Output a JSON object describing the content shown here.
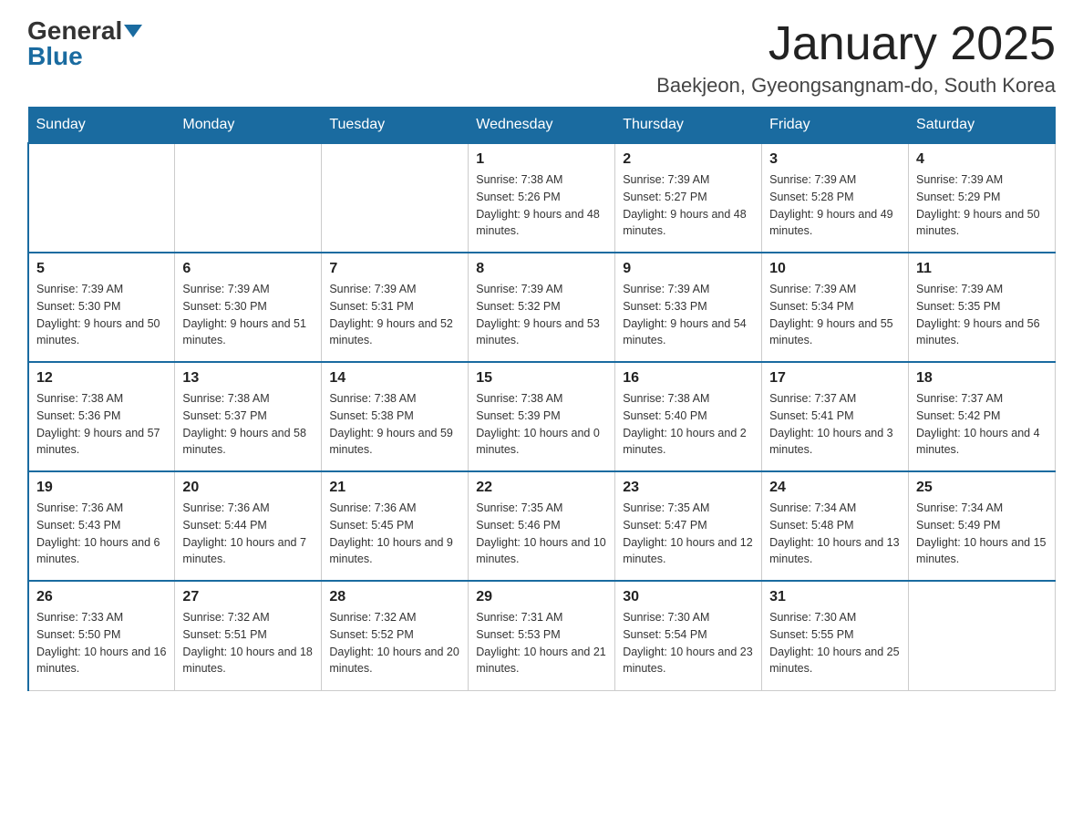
{
  "logo": {
    "general": "General",
    "blue": "Blue"
  },
  "title": "January 2025",
  "location": "Baekjeon, Gyeongsangnam-do, South Korea",
  "days_of_week": [
    "Sunday",
    "Monday",
    "Tuesday",
    "Wednesday",
    "Thursday",
    "Friday",
    "Saturday"
  ],
  "weeks": [
    [
      {
        "day": "",
        "info": ""
      },
      {
        "day": "",
        "info": ""
      },
      {
        "day": "",
        "info": ""
      },
      {
        "day": "1",
        "sunrise": "7:38 AM",
        "sunset": "5:26 PM",
        "daylight": "9 hours and 48 minutes."
      },
      {
        "day": "2",
        "sunrise": "7:39 AM",
        "sunset": "5:27 PM",
        "daylight": "9 hours and 48 minutes."
      },
      {
        "day": "3",
        "sunrise": "7:39 AM",
        "sunset": "5:28 PM",
        "daylight": "9 hours and 49 minutes."
      },
      {
        "day": "4",
        "sunrise": "7:39 AM",
        "sunset": "5:29 PM",
        "daylight": "9 hours and 50 minutes."
      }
    ],
    [
      {
        "day": "5",
        "sunrise": "7:39 AM",
        "sunset": "5:30 PM",
        "daylight": "9 hours and 50 minutes."
      },
      {
        "day": "6",
        "sunrise": "7:39 AM",
        "sunset": "5:30 PM",
        "daylight": "9 hours and 51 minutes."
      },
      {
        "day": "7",
        "sunrise": "7:39 AM",
        "sunset": "5:31 PM",
        "daylight": "9 hours and 52 minutes."
      },
      {
        "day": "8",
        "sunrise": "7:39 AM",
        "sunset": "5:32 PM",
        "daylight": "9 hours and 53 minutes."
      },
      {
        "day": "9",
        "sunrise": "7:39 AM",
        "sunset": "5:33 PM",
        "daylight": "9 hours and 54 minutes."
      },
      {
        "day": "10",
        "sunrise": "7:39 AM",
        "sunset": "5:34 PM",
        "daylight": "9 hours and 55 minutes."
      },
      {
        "day": "11",
        "sunrise": "7:39 AM",
        "sunset": "5:35 PM",
        "daylight": "9 hours and 56 minutes."
      }
    ],
    [
      {
        "day": "12",
        "sunrise": "7:38 AM",
        "sunset": "5:36 PM",
        "daylight": "9 hours and 57 minutes."
      },
      {
        "day": "13",
        "sunrise": "7:38 AM",
        "sunset": "5:37 PM",
        "daylight": "9 hours and 58 minutes."
      },
      {
        "day": "14",
        "sunrise": "7:38 AM",
        "sunset": "5:38 PM",
        "daylight": "9 hours and 59 minutes."
      },
      {
        "day": "15",
        "sunrise": "7:38 AM",
        "sunset": "5:39 PM",
        "daylight": "10 hours and 0 minutes."
      },
      {
        "day": "16",
        "sunrise": "7:38 AM",
        "sunset": "5:40 PM",
        "daylight": "10 hours and 2 minutes."
      },
      {
        "day": "17",
        "sunrise": "7:37 AM",
        "sunset": "5:41 PM",
        "daylight": "10 hours and 3 minutes."
      },
      {
        "day": "18",
        "sunrise": "7:37 AM",
        "sunset": "5:42 PM",
        "daylight": "10 hours and 4 minutes."
      }
    ],
    [
      {
        "day": "19",
        "sunrise": "7:36 AM",
        "sunset": "5:43 PM",
        "daylight": "10 hours and 6 minutes."
      },
      {
        "day": "20",
        "sunrise": "7:36 AM",
        "sunset": "5:44 PM",
        "daylight": "10 hours and 7 minutes."
      },
      {
        "day": "21",
        "sunrise": "7:36 AM",
        "sunset": "5:45 PM",
        "daylight": "10 hours and 9 minutes."
      },
      {
        "day": "22",
        "sunrise": "7:35 AM",
        "sunset": "5:46 PM",
        "daylight": "10 hours and 10 minutes."
      },
      {
        "day": "23",
        "sunrise": "7:35 AM",
        "sunset": "5:47 PM",
        "daylight": "10 hours and 12 minutes."
      },
      {
        "day": "24",
        "sunrise": "7:34 AM",
        "sunset": "5:48 PM",
        "daylight": "10 hours and 13 minutes."
      },
      {
        "day": "25",
        "sunrise": "7:34 AM",
        "sunset": "5:49 PM",
        "daylight": "10 hours and 15 minutes."
      }
    ],
    [
      {
        "day": "26",
        "sunrise": "7:33 AM",
        "sunset": "5:50 PM",
        "daylight": "10 hours and 16 minutes."
      },
      {
        "day": "27",
        "sunrise": "7:32 AM",
        "sunset": "5:51 PM",
        "daylight": "10 hours and 18 minutes."
      },
      {
        "day": "28",
        "sunrise": "7:32 AM",
        "sunset": "5:52 PM",
        "daylight": "10 hours and 20 minutes."
      },
      {
        "day": "29",
        "sunrise": "7:31 AM",
        "sunset": "5:53 PM",
        "daylight": "10 hours and 21 minutes."
      },
      {
        "day": "30",
        "sunrise": "7:30 AM",
        "sunset": "5:54 PM",
        "daylight": "10 hours and 23 minutes."
      },
      {
        "day": "31",
        "sunrise": "7:30 AM",
        "sunset": "5:55 PM",
        "daylight": "10 hours and 25 minutes."
      },
      {
        "day": "",
        "info": ""
      }
    ]
  ],
  "labels": {
    "sunrise": "Sunrise:",
    "sunset": "Sunset:",
    "daylight": "Daylight:"
  }
}
